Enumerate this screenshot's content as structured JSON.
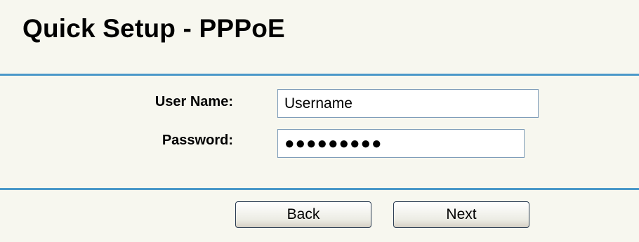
{
  "page": {
    "title": "Quick Setup - PPPoE"
  },
  "form": {
    "username_label": "User Name:",
    "username_value": "Username",
    "password_label": "Password:",
    "password_value": "●●●●●●●●●"
  },
  "buttons": {
    "back_label": "Back",
    "next_label": "Next"
  },
  "colors": {
    "background": "#f7f7ef",
    "divider": "#4a98c9"
  }
}
